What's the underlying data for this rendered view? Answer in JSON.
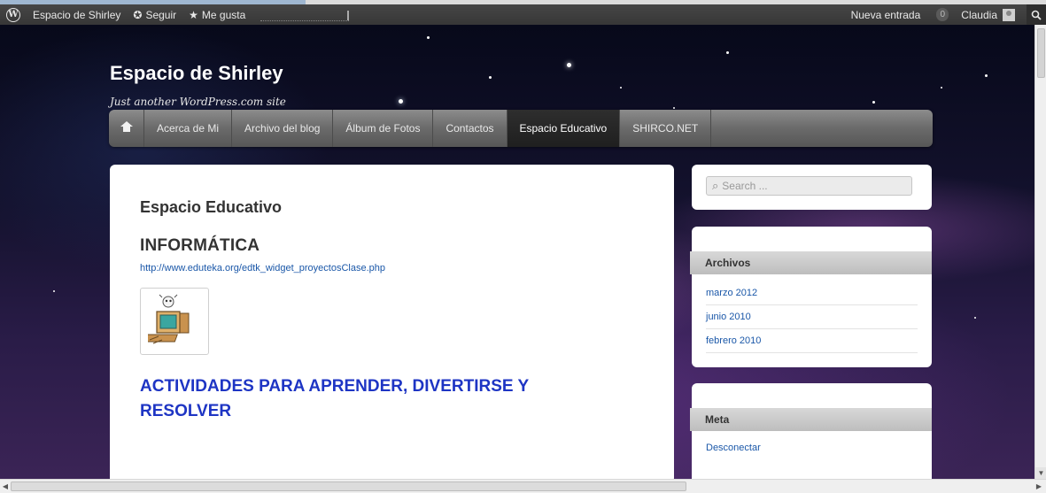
{
  "adminbar": {
    "site_name": "Espacio de Shirley",
    "follow_label": "Seguir",
    "like_label": "Me gusta",
    "new_post_label": "Nueva entrada",
    "notification_count": "0",
    "user_name": "Claudia"
  },
  "site": {
    "title": "Espacio de Shirley",
    "description": "Just another WordPress.com site"
  },
  "nav": {
    "items": [
      {
        "label": "Acerca de Mi"
      },
      {
        "label": "Archivo del blog"
      },
      {
        "label": "Álbum de Fotos"
      },
      {
        "label": "Contactos"
      },
      {
        "label": "Espacio Educativo"
      },
      {
        "label": "SHIRCO.NET"
      }
    ],
    "active": "Espacio Educativo"
  },
  "content": {
    "page_title": "Espacio Educativo",
    "heading_informatica": "INFORMÁTICA",
    "link_url": "http://www.eduteka.org/edtk_widget_proyectosClase.php",
    "heading_actividades": "ACTIVIDADES PARA APRENDER, DIVERTIRSE  Y RESOLVER"
  },
  "sidebar": {
    "search_placeholder": "Search ...",
    "archives": {
      "title": "Archivos",
      "items": [
        "marzo 2012",
        "junio 2010",
        "febrero 2010"
      ]
    },
    "meta": {
      "title": "Meta",
      "items": [
        "Desconectar"
      ]
    }
  },
  "icons": {
    "wordpress": "wordpress-logo-icon",
    "follow": "plus-circle-icon",
    "like": "star-icon",
    "home": "home-icon",
    "search": "magnifier-icon"
  },
  "colors": {
    "adminbar_bg": "#464646",
    "nav_active_bg": "#2e2e2e",
    "link": "#1a57a8",
    "heading_blue": "#1e35c4"
  }
}
